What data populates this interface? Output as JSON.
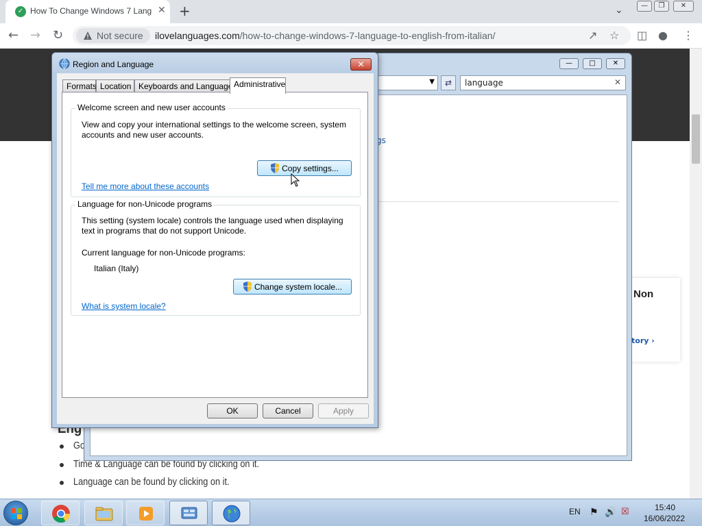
{
  "browser": {
    "tab_title": "How To Change Windows 7 Lang",
    "security_label": "Not secure",
    "url_host": "ilovelanguages.com",
    "url_path": "/how-to-change-windows-7-language-to-english-from-italian/"
  },
  "page": {
    "heading_fragment": "Eng",
    "bullets": [
      "Go",
      "Time & Language can be found by clicking on it.",
      "Language can be found by clicking on it."
    ],
    "card_title": "Non",
    "card_link": "tory ›",
    "behind_link": "gs"
  },
  "control_panel": {
    "search_value": "language"
  },
  "dialog": {
    "title": "Region and Language",
    "tabs": [
      "Formats",
      "Location",
      "Keyboards and Languages",
      "Administrative"
    ],
    "active_tab": "Administrative",
    "welcome": {
      "group_title": "Welcome screen and new user accounts",
      "description": "View and copy your international settings to the welcome screen, system accounts and new user accounts.",
      "copy_button": "Copy settings...",
      "link": "Tell me more about these accounts"
    },
    "nonunicode": {
      "group_title": "Language for non-Unicode programs",
      "description": "This setting (system locale) controls the language used when displaying text in programs that do not support Unicode.",
      "current_label": "Current language for non-Unicode programs:",
      "current_value": "Italian (Italy)",
      "change_button": "Change system locale...",
      "link": "What is system locale?"
    },
    "buttons": {
      "ok": "OK",
      "cancel": "Cancel",
      "apply": "Apply"
    }
  },
  "taskbar": {
    "language": "EN",
    "time": "15:40",
    "date": "16/06/2022"
  },
  "colors": {
    "link_blue": "#0066cc",
    "taskbar": "#b3cae4",
    "dialog_frame": "#b8cde3"
  }
}
